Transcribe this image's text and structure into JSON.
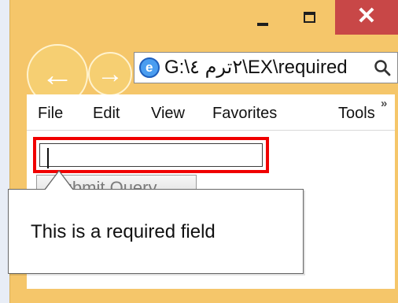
{
  "window": {
    "controls": {
      "minimize_label": "",
      "maximize_label": "",
      "close_label": "✕"
    },
    "accent_color": "#f5c66a",
    "close_color": "#c84747"
  },
  "navigation": {
    "address": "G:\\٢ترم ٤\\EX\\required",
    "page_icon": "e"
  },
  "menu": {
    "items": [
      "File",
      "Edit",
      "View",
      "Favorites",
      "Tools"
    ],
    "overflow": "»"
  },
  "form": {
    "input_value": "",
    "submit_label": "Submit Query"
  },
  "validation": {
    "message": "This is a required field",
    "border_color": "#f00000"
  }
}
